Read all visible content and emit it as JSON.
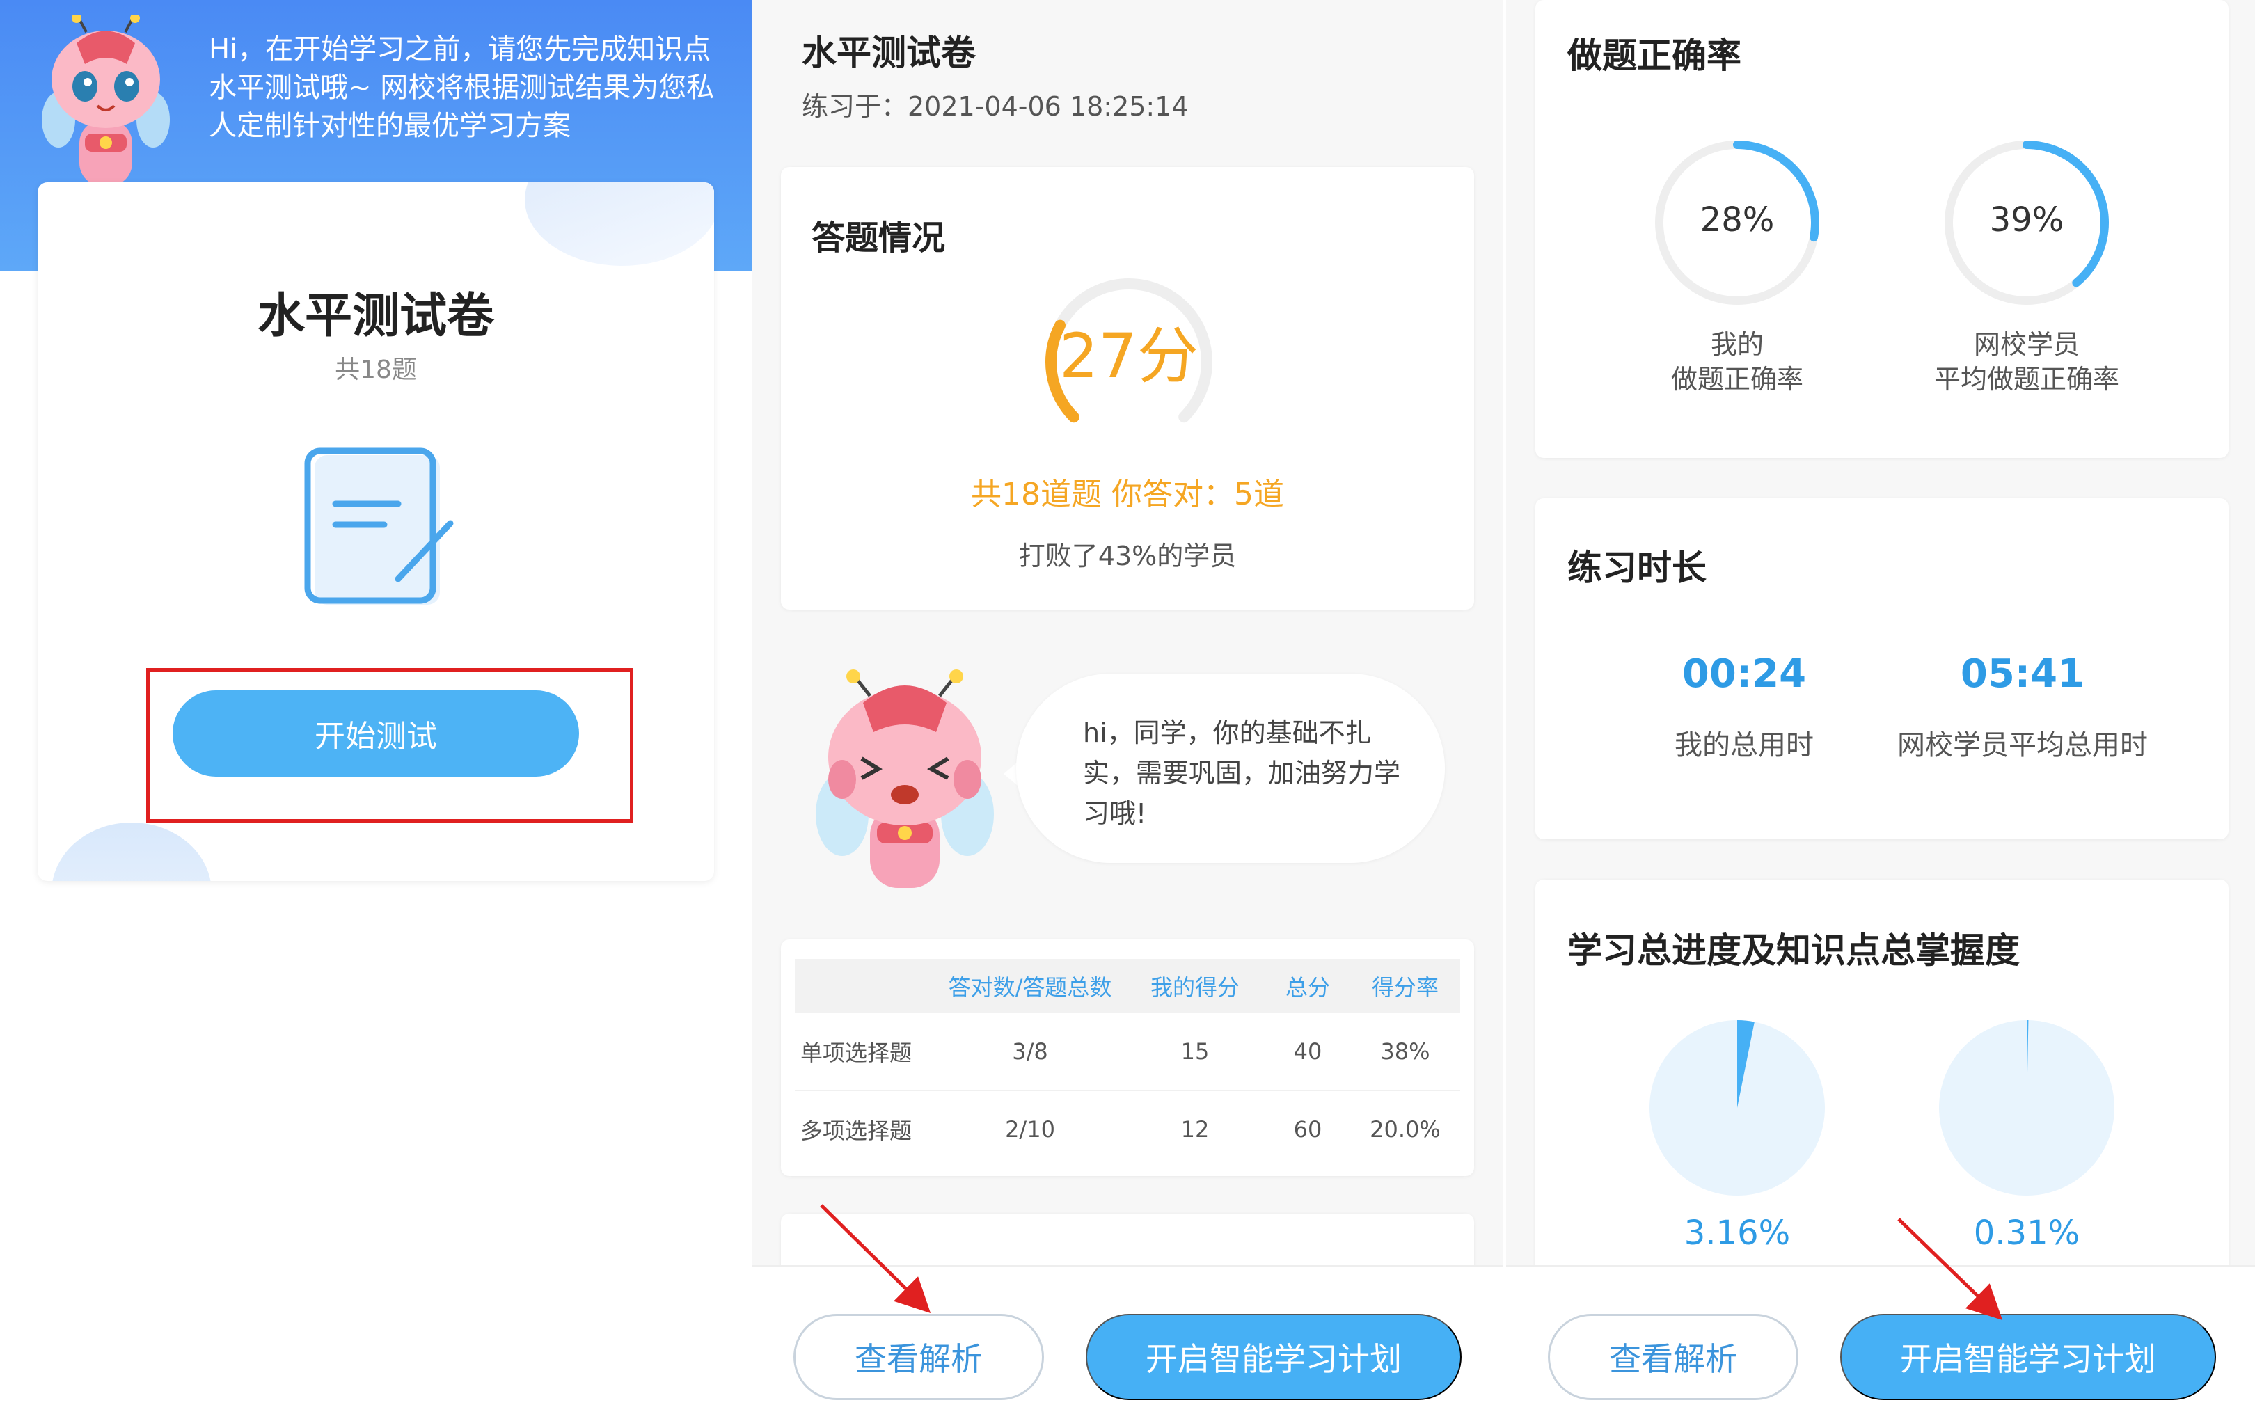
{
  "panel_intro": {
    "intro_text": "Hi，在开始学习之前，请您先完成知识点水平测试哦~ 网校将根据测试结果为您私人定制针对性的最优学习方案",
    "card_title": "水平测试卷",
    "question_count": "共18题",
    "start_button": "开始测试",
    "icons": [
      "mascot-bee",
      "document-edit"
    ]
  },
  "panel_result": {
    "title": "水平测试卷",
    "practiced_at": "练习于：2021-04-06 18:25:14",
    "answer_section": {
      "title": "答题情况",
      "score": "27分",
      "score_fraction": 0.27,
      "summary": "共18道题 你答对：5道",
      "beat_text": "打败了43%的学员"
    },
    "encouragement": "hi，同学，你的基础不扎实，需要巩固，加油努力学习哦!",
    "table": {
      "headers": [
        "",
        "答对数/答题总数",
        "我的得分",
        "总分",
        "得分率"
      ],
      "rows": [
        {
          "type": "单项选择题",
          "correct": "3/8",
          "score": "15",
          "total": "40",
          "rate": "38%"
        },
        {
          "type": "多项选择题",
          "correct": "2/10",
          "score": "12",
          "total": "60",
          "rate": "20.0%"
        }
      ]
    }
  },
  "panel_stats": {
    "accuracy": {
      "title": "做题正确率",
      "mine": {
        "value": "28%",
        "fraction": 0.28,
        "label_line1": "我的",
        "label_line2": "做题正确率"
      },
      "average": {
        "value": "39%",
        "fraction": 0.39,
        "label_line1": "网校学员",
        "label_line2": "平均做题正确率"
      }
    },
    "duration": {
      "title": "练习时长",
      "mine": {
        "value": "00:24",
        "label": "我的总用时"
      },
      "average": {
        "value": "05:41",
        "label": "网校学员平均总用时"
      }
    },
    "progress": {
      "title": "学习总进度及知识点总掌握度",
      "first": {
        "value": "3.16%",
        "fraction": 0.0316
      },
      "second": {
        "value": "0.31%",
        "fraction": 0.0031
      }
    }
  },
  "footer": {
    "view_analysis": "查看解析",
    "start_plan": "开启智能学习计划"
  },
  "colors": {
    "accent_blue": "#46b0f5",
    "score_orange": "#f5a623",
    "annotation_red": "#e02020"
  }
}
